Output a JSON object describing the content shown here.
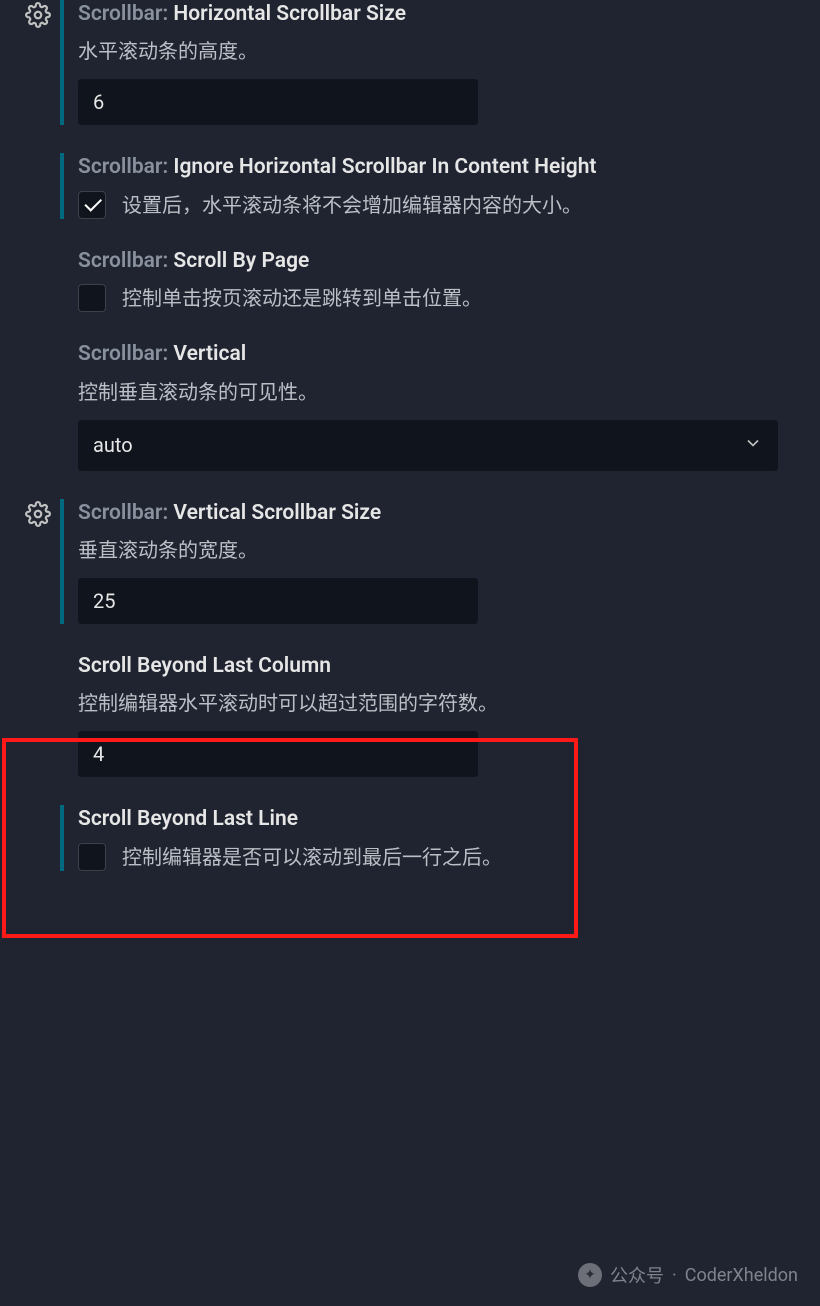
{
  "settings": {
    "horizontalSize": {
      "prefix": "Scrollbar:",
      "name": "Horizontal Scrollbar Size",
      "desc": "水平滚动条的高度。",
      "value": "6"
    },
    "ignoreHorizontal": {
      "prefix": "Scrollbar:",
      "name": "Ignore Horizontal Scrollbar In Content Height",
      "desc": "设置后，水平滚动条将不会增加编辑器内容的大小。"
    },
    "scrollByPage": {
      "prefix": "Scrollbar:",
      "name": "Scroll By Page",
      "desc": "控制单击按页滚动还是跳转到单击位置。"
    },
    "vertical": {
      "prefix": "Scrollbar:",
      "name": "Vertical",
      "desc": "控制垂直滚动条的可见性。",
      "value": "auto"
    },
    "verticalSize": {
      "prefix": "Scrollbar:",
      "name": "Vertical Scrollbar Size",
      "desc": "垂直滚动条的宽度。",
      "value": "25"
    },
    "beyondLastColumn": {
      "name": "Scroll Beyond Last Column",
      "desc": "控制编辑器水平滚动时可以超过范围的字符数。",
      "value": "4"
    },
    "beyondLastLine": {
      "name": "Scroll Beyond Last Line",
      "desc": "控制编辑器是否可以滚动到最后一行之后。"
    }
  },
  "watermark": {
    "label": "公众号",
    "sep": "·",
    "author": "CoderXheldon"
  }
}
